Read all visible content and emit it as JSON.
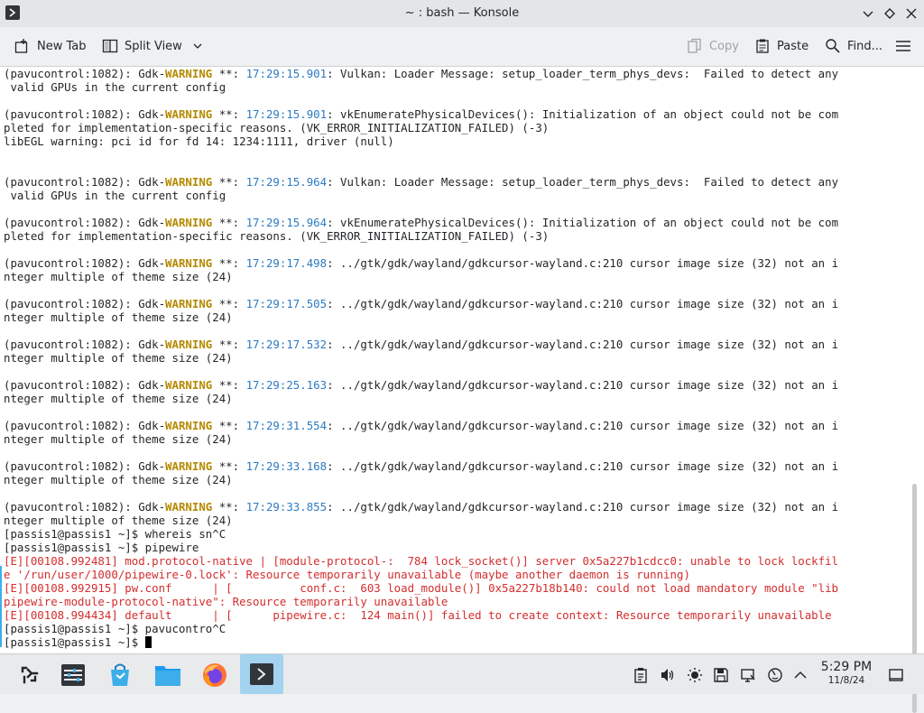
{
  "window": {
    "title": "~ : bash — Konsole"
  },
  "toolbar": {
    "new_tab": "New Tab",
    "split_view": "Split View",
    "copy": "Copy",
    "paste": "Paste",
    "find": "Find..."
  },
  "terminal": {
    "lines": [
      [
        {
          "t": "(pavucontrol:1082): Gdk-"
        },
        {
          "t": "WARNING",
          "c": "w"
        },
        {
          "t": " **: "
        },
        {
          "t": "17:29:15.901",
          "c": "t"
        },
        {
          "t": ": Vulkan: Loader Message: setup_loader_term_phys_devs:  Failed to detect any"
        }
      ],
      [
        {
          "t": " valid GPUs in the current config"
        }
      ],
      [
        {
          "t": ""
        }
      ],
      [
        {
          "t": "(pavucontrol:1082): Gdk-"
        },
        {
          "t": "WARNING",
          "c": "w"
        },
        {
          "t": " **: "
        },
        {
          "t": "17:29:15.901",
          "c": "t"
        },
        {
          "t": ": vkEnumeratePhysicalDevices(): Initialization of an object could not be com"
        }
      ],
      [
        {
          "t": "pleted for implementation-specific reasons. (VK_ERROR_INITIALIZATION_FAILED) (-3)"
        }
      ],
      [
        {
          "t": "libEGL warning: pci id for fd 14: 1234:1111, driver (null)"
        }
      ],
      [
        {
          "t": ""
        }
      ],
      [
        {
          "t": ""
        }
      ],
      [
        {
          "t": "(pavucontrol:1082): Gdk-"
        },
        {
          "t": "WARNING",
          "c": "w"
        },
        {
          "t": " **: "
        },
        {
          "t": "17:29:15.964",
          "c": "t"
        },
        {
          "t": ": Vulkan: Loader Message: setup_loader_term_phys_devs:  Failed to detect any"
        }
      ],
      [
        {
          "t": " valid GPUs in the current config"
        }
      ],
      [
        {
          "t": ""
        }
      ],
      [
        {
          "t": "(pavucontrol:1082): Gdk-"
        },
        {
          "t": "WARNING",
          "c": "w"
        },
        {
          "t": " **: "
        },
        {
          "t": "17:29:15.964",
          "c": "t"
        },
        {
          "t": ": vkEnumeratePhysicalDevices(): Initialization of an object could not be com"
        }
      ],
      [
        {
          "t": "pleted for implementation-specific reasons. (VK_ERROR_INITIALIZATION_FAILED) (-3)"
        }
      ],
      [
        {
          "t": ""
        }
      ],
      [
        {
          "t": "(pavucontrol:1082): Gdk-"
        },
        {
          "t": "WARNING",
          "c": "w"
        },
        {
          "t": " **: "
        },
        {
          "t": "17:29:17.498",
          "c": "t"
        },
        {
          "t": ": ../gtk/gdk/wayland/gdkcursor-wayland.c:210 cursor image size (32) not an i"
        }
      ],
      [
        {
          "t": "nteger multiple of theme size (24)"
        }
      ],
      [
        {
          "t": ""
        }
      ],
      [
        {
          "t": "(pavucontrol:1082): Gdk-"
        },
        {
          "t": "WARNING",
          "c": "w"
        },
        {
          "t": " **: "
        },
        {
          "t": "17:29:17.505",
          "c": "t"
        },
        {
          "t": ": ../gtk/gdk/wayland/gdkcursor-wayland.c:210 cursor image size (32) not an i"
        }
      ],
      [
        {
          "t": "nteger multiple of theme size (24)"
        }
      ],
      [
        {
          "t": ""
        }
      ],
      [
        {
          "t": "(pavucontrol:1082): Gdk-"
        },
        {
          "t": "WARNING",
          "c": "w"
        },
        {
          "t": " **: "
        },
        {
          "t": "17:29:17.532",
          "c": "t"
        },
        {
          "t": ": ../gtk/gdk/wayland/gdkcursor-wayland.c:210 cursor image size (32) not an i"
        }
      ],
      [
        {
          "t": "nteger multiple of theme size (24)"
        }
      ],
      [
        {
          "t": ""
        }
      ],
      [
        {
          "t": "(pavucontrol:1082): Gdk-"
        },
        {
          "t": "WARNING",
          "c": "w"
        },
        {
          "t": " **: "
        },
        {
          "t": "17:29:25.163",
          "c": "t"
        },
        {
          "t": ": ../gtk/gdk/wayland/gdkcursor-wayland.c:210 cursor image size (32) not an i"
        }
      ],
      [
        {
          "t": "nteger multiple of theme size (24)"
        }
      ],
      [
        {
          "t": ""
        }
      ],
      [
        {
          "t": "(pavucontrol:1082): Gdk-"
        },
        {
          "t": "WARNING",
          "c": "w"
        },
        {
          "t": " **: "
        },
        {
          "t": "17:29:31.554",
          "c": "t"
        },
        {
          "t": ": ../gtk/gdk/wayland/gdkcursor-wayland.c:210 cursor image size (32) not an i"
        }
      ],
      [
        {
          "t": "nteger multiple of theme size (24)"
        }
      ],
      [
        {
          "t": ""
        }
      ],
      [
        {
          "t": "(pavucontrol:1082): Gdk-"
        },
        {
          "t": "WARNING",
          "c": "w"
        },
        {
          "t": " **: "
        },
        {
          "t": "17:29:33.168",
          "c": "t"
        },
        {
          "t": ": ../gtk/gdk/wayland/gdkcursor-wayland.c:210 cursor image size (32) not an i"
        }
      ],
      [
        {
          "t": "nteger multiple of theme size (24)"
        }
      ],
      [
        {
          "t": ""
        }
      ],
      [
        {
          "t": "(pavucontrol:1082): Gdk-"
        },
        {
          "t": "WARNING",
          "c": "w"
        },
        {
          "t": " **: "
        },
        {
          "t": "17:29:33.855",
          "c": "t"
        },
        {
          "t": ": ../gtk/gdk/wayland/gdkcursor-wayland.c:210 cursor image size (32) not an i"
        }
      ],
      [
        {
          "t": "nteger multiple of theme size (24)"
        }
      ],
      [
        {
          "t": "[passis1@passis1 ~]$ whereis sn^C"
        }
      ],
      [
        {
          "t": "[passis1@passis1 ~]$ pipewire"
        }
      ],
      [
        {
          "t": "[E][00108.992481] mod.protocol-native | [module-protocol-:  784 lock_socket()] server 0x5a227b1cdcc0: unable to lock lockfil",
          "c": "e"
        }
      ],
      [
        {
          "t": "e '/run/user/1000/pipewire-0.lock': Resource temporarily unavailable (maybe another daemon is running)",
          "c": "e"
        }
      ],
      [
        {
          "t": "[E][00108.992915] pw.conf      | [          conf.c:  603 load_module()] 0x5a227b18b140: could not load mandatory module \"lib",
          "c": "e"
        }
      ],
      [
        {
          "t": "pipewire-module-protocol-native\": Resource temporarily unavailable",
          "c": "e"
        }
      ],
      [
        {
          "t": "[E][00108.994434] default      | [      pipewire.c:  124 main()] failed to create context: Resource temporarily unavailable",
          "c": "e"
        }
      ],
      [
        {
          "t": "[passis1@passis1 ~]$ pavucontro^C"
        }
      ],
      [
        {
          "t": "[passis1@passis1 ~]$ "
        }
      ]
    ]
  },
  "taskbar": {
    "time": "5:29 PM",
    "date": "11/8/24"
  },
  "colors": {
    "warning": "#b58900",
    "timestamp": "#2c7bc3",
    "error": "#d42d2d",
    "accent": "#3daee9"
  }
}
